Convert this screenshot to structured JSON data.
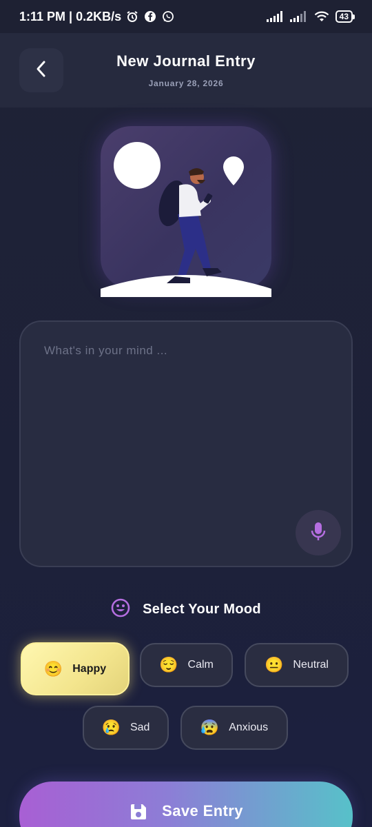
{
  "status_bar": {
    "time_and_speed": "1:11 PM | 0.2KB/s",
    "battery": "43"
  },
  "header": {
    "title": "New Journal Entry",
    "date": "January 28, 2026"
  },
  "editor": {
    "placeholder": "What's in your mind ..."
  },
  "mood": {
    "heading": "Select Your Mood",
    "selected": "Happy",
    "options": [
      {
        "label": "Happy",
        "emoji": "😊"
      },
      {
        "label": "Calm",
        "emoji": "😌"
      },
      {
        "label": "Neutral",
        "emoji": "😐"
      },
      {
        "label": "Sad",
        "emoji": "😢"
      },
      {
        "label": "Anxious",
        "emoji": "😰"
      }
    ]
  },
  "save_button": {
    "label": "Save Entry"
  },
  "colors": {
    "background": "#1f2236",
    "header_background": "#262a3e",
    "card_background": "#282c41",
    "accent_purple": "#b56ee0",
    "selected_mood": "#f3e58d",
    "save_gradient_start": "#a85fd4",
    "save_gradient_end": "#57c1c9"
  },
  "icons": {
    "back": "chevron-left-icon",
    "mic": "microphone-icon",
    "mood": "smiley-face-icon",
    "save": "floppy-disk-icon"
  }
}
